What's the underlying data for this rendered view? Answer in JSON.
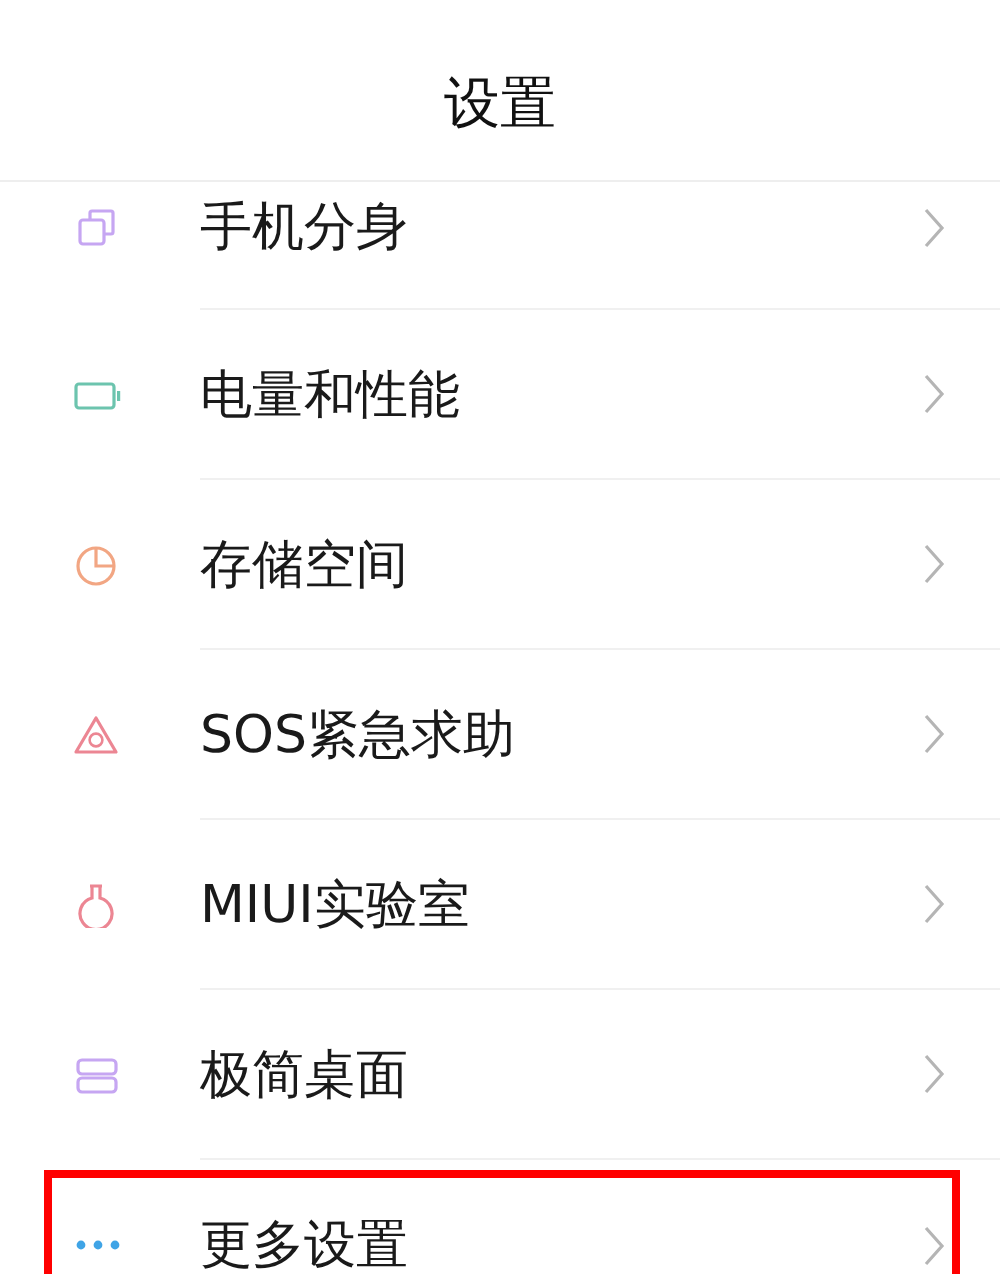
{
  "header": {
    "title": "设置"
  },
  "items": [
    {
      "label": "手机分身",
      "color": "#c6a6f2",
      "highlighted": false
    },
    {
      "label": "电量和性能",
      "color": "#6cc4ae",
      "highlighted": false
    },
    {
      "label": "存储空间",
      "color": "#f2a683",
      "highlighted": false
    },
    {
      "label": "SOS紧急求助",
      "color": "#ec8693",
      "highlighted": false
    },
    {
      "label": "MIUI实验室",
      "color": "#ec8693",
      "highlighted": false
    },
    {
      "label": "极简桌面",
      "color": "#c6a6f2",
      "highlighted": false
    },
    {
      "label": "更多设置",
      "color": "#3fa4e6",
      "highlighted": true
    }
  ]
}
